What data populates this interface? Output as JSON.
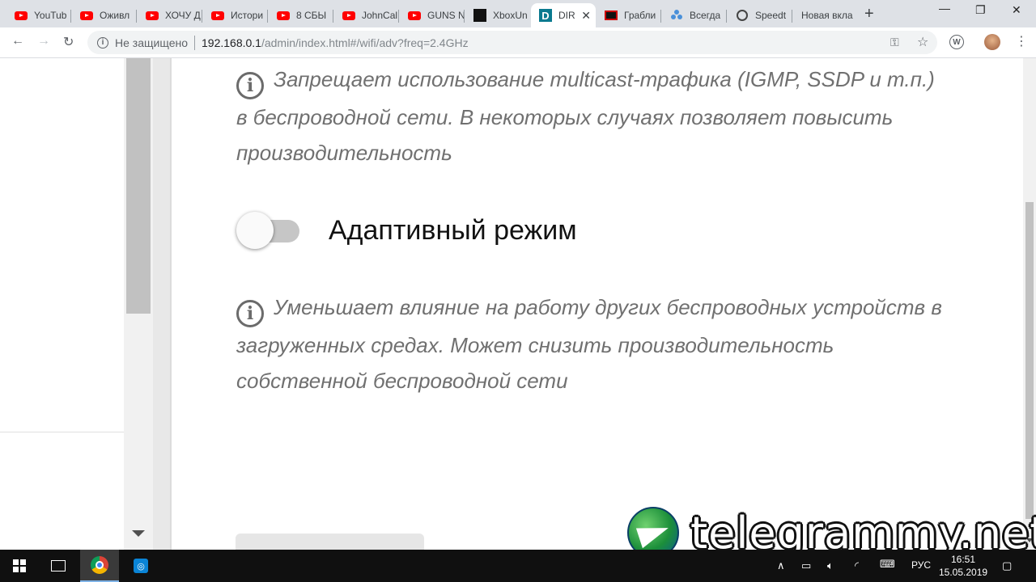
{
  "browser": {
    "tabs": [
      {
        "title": "YouTub",
        "favicon": "youtube-icon"
      },
      {
        "title": "Оживл",
        "favicon": "youtube-icon"
      },
      {
        "title": "ХОЧУ Д",
        "favicon": "youtube-icon"
      },
      {
        "title": "Истори",
        "favicon": "youtube-icon"
      },
      {
        "title": "8 СБЫ",
        "favicon": "youtube-icon"
      },
      {
        "title": "JohnCal",
        "favicon": "youtube-icon"
      },
      {
        "title": "GUNS N",
        "favicon": "youtube-icon"
      },
      {
        "title": "XboxUn",
        "favicon": "xbox-site-icon"
      },
      {
        "title": "DIR",
        "favicon": "dlink-icon",
        "active": true
      },
      {
        "title": "Грабли",
        "favicon": "site-icon"
      },
      {
        "title": "Всегда",
        "favicon": "dots-icon"
      },
      {
        "title": "Speedt",
        "favicon": "speedtest-icon"
      },
      {
        "title": "Новая вкла",
        "favicon": ""
      }
    ],
    "address": {
      "security_label": "Не защищено",
      "host": "192.168.0.1",
      "path": "/admin/index.html#/wifi/adv?freq=2.4GHz"
    }
  },
  "page": {
    "hint_multicast": "Запрещает использование multicast-трафика (IGMP, SSDP и т.п.) в беспроводной сети. В некоторых случаях позволяет повысить производительность",
    "adaptive": {
      "label": "Адаптивный режим",
      "enabled": false
    },
    "hint_adaptive": "Уменьшает влияние на работу других беспроводных устройств в загруженных средах. Может снизить производительность собственной беспроводной сети"
  },
  "watermark": {
    "text": "telegrammy.net"
  },
  "taskbar": {
    "language": "РУС",
    "time": "16:51",
    "date": "15.05.2019"
  },
  "colors": {
    "hint_text": "#707070",
    "switch_track": "#c6c6c6",
    "tab_strip": "#dee1e6"
  }
}
